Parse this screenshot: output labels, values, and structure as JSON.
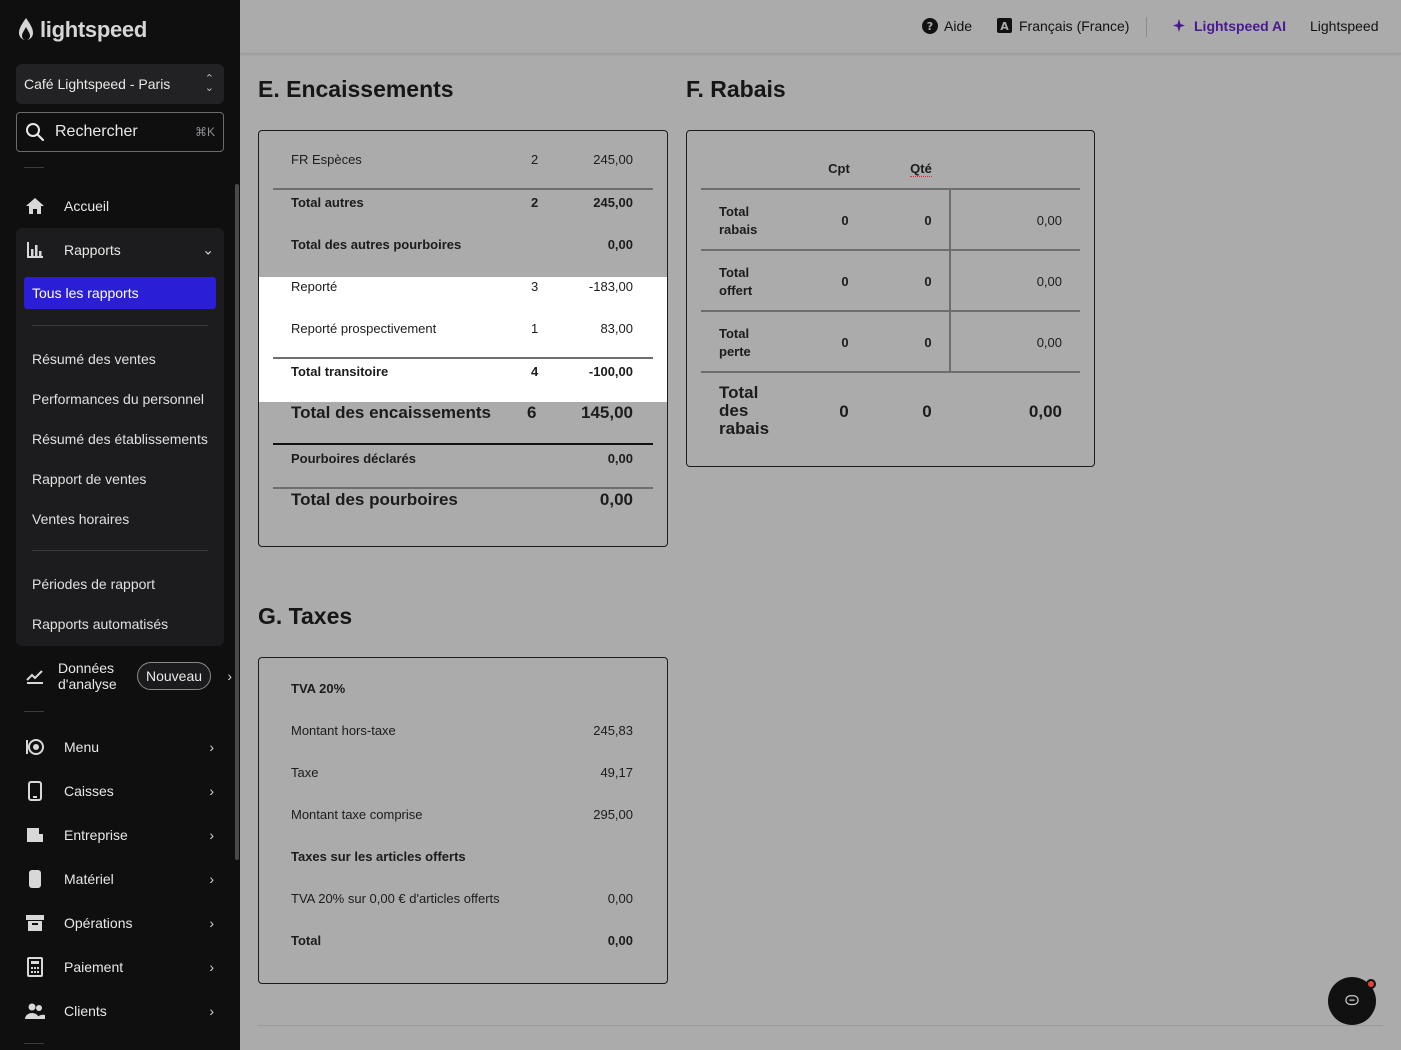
{
  "sidebar": {
    "logo_text": "lightspeed",
    "venue": "Café Lightspeed - Paris",
    "search_label": "Rechercher",
    "search_shortcut": "⌘K",
    "home": "Accueil",
    "reports": "Rapports",
    "reports_sub": {
      "active": "Tous les rapports",
      "items1": [
        "Résumé des ventes",
        "Performances du personnel",
        "Résumé des établissements",
        "Rapport de ventes",
        "Ventes horaires"
      ],
      "items2": [
        "Périodes de rapport",
        "Rapports automatisés"
      ]
    },
    "analytics": "Données d'analyse",
    "analytics_badge": "Nouveau",
    "nav": [
      "Menu",
      "Caisses",
      "Entreprise",
      "Matériel",
      "Opérations",
      "Paiement",
      "Clients"
    ]
  },
  "topbar": {
    "help": "Aide",
    "language": "Français (France)",
    "ai": "Lightspeed AI",
    "account": "Lightspeed"
  },
  "encaissements": {
    "title": "E. Encaissements",
    "rows": [
      {
        "label": "FR Espèces",
        "count": "2",
        "amount": "245,00"
      },
      {
        "label": "Total autres",
        "count": "2",
        "amount": "245,00"
      },
      {
        "label": "Total des autres pourboires",
        "count": "",
        "amount": "0,00"
      },
      {
        "label": "Reporté",
        "count": "3",
        "amount": "-183,00"
      },
      {
        "label": "Reporté prospectivement",
        "count": "1",
        "amount": "83,00"
      },
      {
        "label": "Total transitoire",
        "count": "4",
        "amount": "-100,00"
      },
      {
        "label": "Total des encaissements",
        "count": "6",
        "amount": "145,00"
      },
      {
        "label": "Pourboires déclarés",
        "count": "",
        "amount": "0,00"
      },
      {
        "label": "Total des pourboires",
        "count": "",
        "amount": "0,00"
      }
    ]
  },
  "rabais": {
    "title": "F. Rabais",
    "headers": [
      "Cpt",
      "Qté"
    ],
    "rows": [
      {
        "label": "Total rabais",
        "cpt": "0",
        "qte": "0",
        "amount": "0,00"
      },
      {
        "label": "Total offert",
        "cpt": "0",
        "qte": "0",
        "amount": "0,00"
      },
      {
        "label": "Total perte",
        "cpt": "0",
        "qte": "0",
        "amount": "0,00"
      },
      {
        "label": "Total des rabais",
        "cpt": "0",
        "qte": "0",
        "amount": "0,00"
      }
    ]
  },
  "taxes": {
    "title": "G. Taxes",
    "rows": [
      {
        "label": "TVA 20%",
        "amount": ""
      },
      {
        "label": "Montant hors-taxe",
        "amount": "245,83"
      },
      {
        "label": "Taxe",
        "amount": "49,17"
      },
      {
        "label": "Montant taxe comprise",
        "amount": "295,00"
      },
      {
        "label": "Taxes sur les articles offerts",
        "amount": ""
      },
      {
        "label": "TVA 20% sur 0,00 € d'articles offerts",
        "amount": "0,00"
      },
      {
        "label": "Total",
        "amount": "0,00"
      }
    ]
  }
}
